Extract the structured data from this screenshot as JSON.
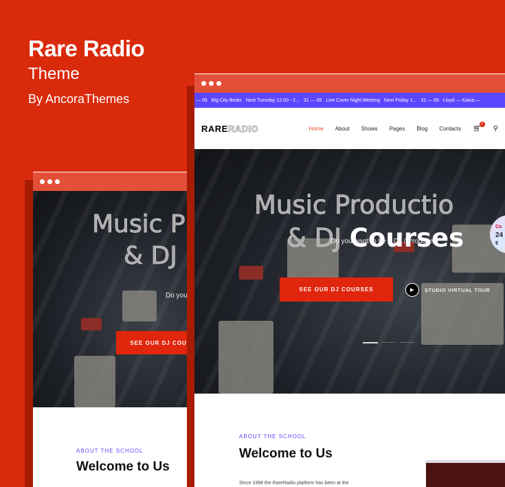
{
  "brand": {
    "title": "Rare Radio",
    "subtitle": "Theme",
    "by": "By AncoraThemes"
  },
  "ticker": [
    "— 05",
    "Big City Beats",
    "Next Tuesday 12.00 - 2...",
    "31 — 05",
    "Live Cover Night Meeting",
    "Next Friday 1...",
    "31 — 05",
    "Lloyd — Kiana —"
  ],
  "nav": {
    "logo_a": "RARE",
    "logo_b": "RADIO",
    "items": [
      "Home",
      "About",
      "Shows",
      "Pages",
      "Blog",
      "Contacts"
    ],
    "cart_count": "0"
  },
  "hero": {
    "line1": "Music Productio",
    "line2_outline": "& DJ",
    "line2_solid": "Courses",
    "question": "Do you want to be a DJ / Producer?",
    "cta": "SEE OUR DJ COURSES",
    "tour": "STUDIO VIRTUAL TOUR",
    "badge_top": "Co",
    "badge_mid": "24",
    "badge_bot": "$"
  },
  "back": {
    "line1": "Music P",
    "line2": "& DJ",
    "question": "Do you w",
    "cta": "SEE OUR DJ COUR"
  },
  "about": {
    "label": "ABOUT THE SCHOOL",
    "title": "Welcome to Us",
    "text": "Since 1996 the RareRadio platform has been at the"
  },
  "colors": {
    "bg": "#da2a0c",
    "accent": "#5c47ff",
    "cta": "#e0260c"
  }
}
